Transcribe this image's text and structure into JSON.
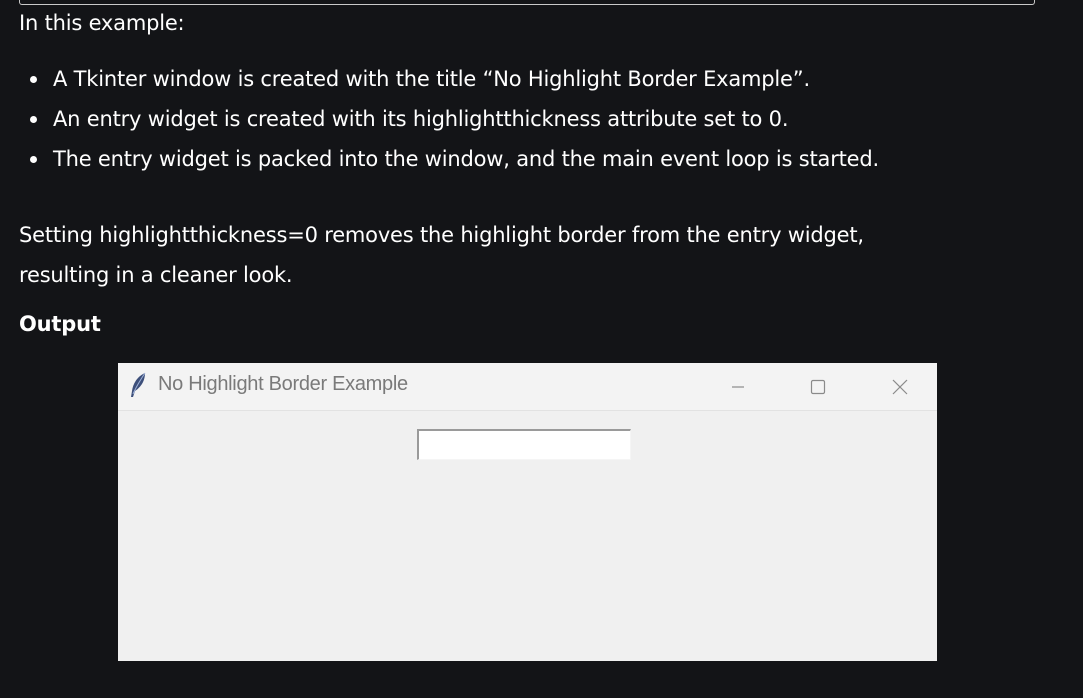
{
  "intro_text": "In this example:",
  "bullets": [
    "A Tkinter window is created with the title “No Highlight Border Example”.",
    "An entry widget is created with its highlightthickness attribute set to 0.",
    "The entry widget is packed into the window, and the main event loop is started."
  ],
  "paragraph": {
    "line1": "Setting highlightthickness=0 removes the highlight border from the entry widget,",
    "line2": "resulting in a cleaner look."
  },
  "output_heading": "Output",
  "tk_window": {
    "title": "No Highlight Border Example",
    "icon": "feather-icon",
    "controls": [
      "minimize-icon",
      "maximize-icon",
      "close-icon"
    ],
    "entry_value": ""
  },
  "colors": {
    "page_background": "#131417",
    "text": "#ffffff",
    "window_background": "#f0f0f0"
  }
}
